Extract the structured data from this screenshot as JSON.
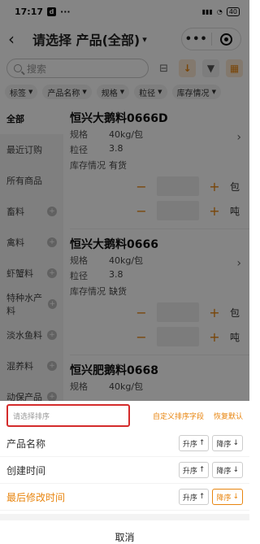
{
  "status": {
    "time": "17:17",
    "dots": "···",
    "battery": "40"
  },
  "nav": {
    "title": "请选择 产品(全部)",
    "more": "•••"
  },
  "search": {
    "placeholder": "搜索"
  },
  "chips": [
    "标签",
    "产品名称",
    "规格",
    "粒径",
    "库存情况"
  ],
  "sidebar": [
    "全部",
    "最近订购",
    "所有商品",
    "畜料",
    "禽料",
    "虾蟹料",
    "特种水产料",
    "淡水鱼料",
    "混养料",
    "动保产品"
  ],
  "products": [
    {
      "name": "恒兴大鹅料0666D",
      "spec_k": "规格",
      "spec_v": "40kg/包",
      "size_k": "粒径",
      "size_v": "3.8",
      "stock_k": "库存情况",
      "stock_v": "有货",
      "unit1": "包",
      "unit2": "吨"
    },
    {
      "name": "恒兴大鹅料0666",
      "spec_k": "规格",
      "spec_v": "40kg/包",
      "size_k": "粒径",
      "size_v": "3.8",
      "stock_k": "库存情况",
      "stock_v": "缺货",
      "unit1": "包",
      "unit2": "吨"
    },
    {
      "name": "恒兴肥鹅料0668",
      "spec_k": "规格",
      "spec_v": "40kg/包"
    }
  ],
  "sheet": {
    "placeholder": "请选择排序",
    "custom_field": "自定义排序字段",
    "restore_default": "恢复默认",
    "options": [
      {
        "label": "产品名称",
        "asc": "升序",
        "desc": "降序"
      },
      {
        "label": "创建时间",
        "asc": "升序",
        "desc": "降序"
      },
      {
        "label": "最后修改时间",
        "asc": "升序",
        "desc": "降序"
      }
    ],
    "cancel": "取消"
  },
  "colors": {
    "accent": "#e8850f",
    "highlight": "#d42b2b"
  }
}
